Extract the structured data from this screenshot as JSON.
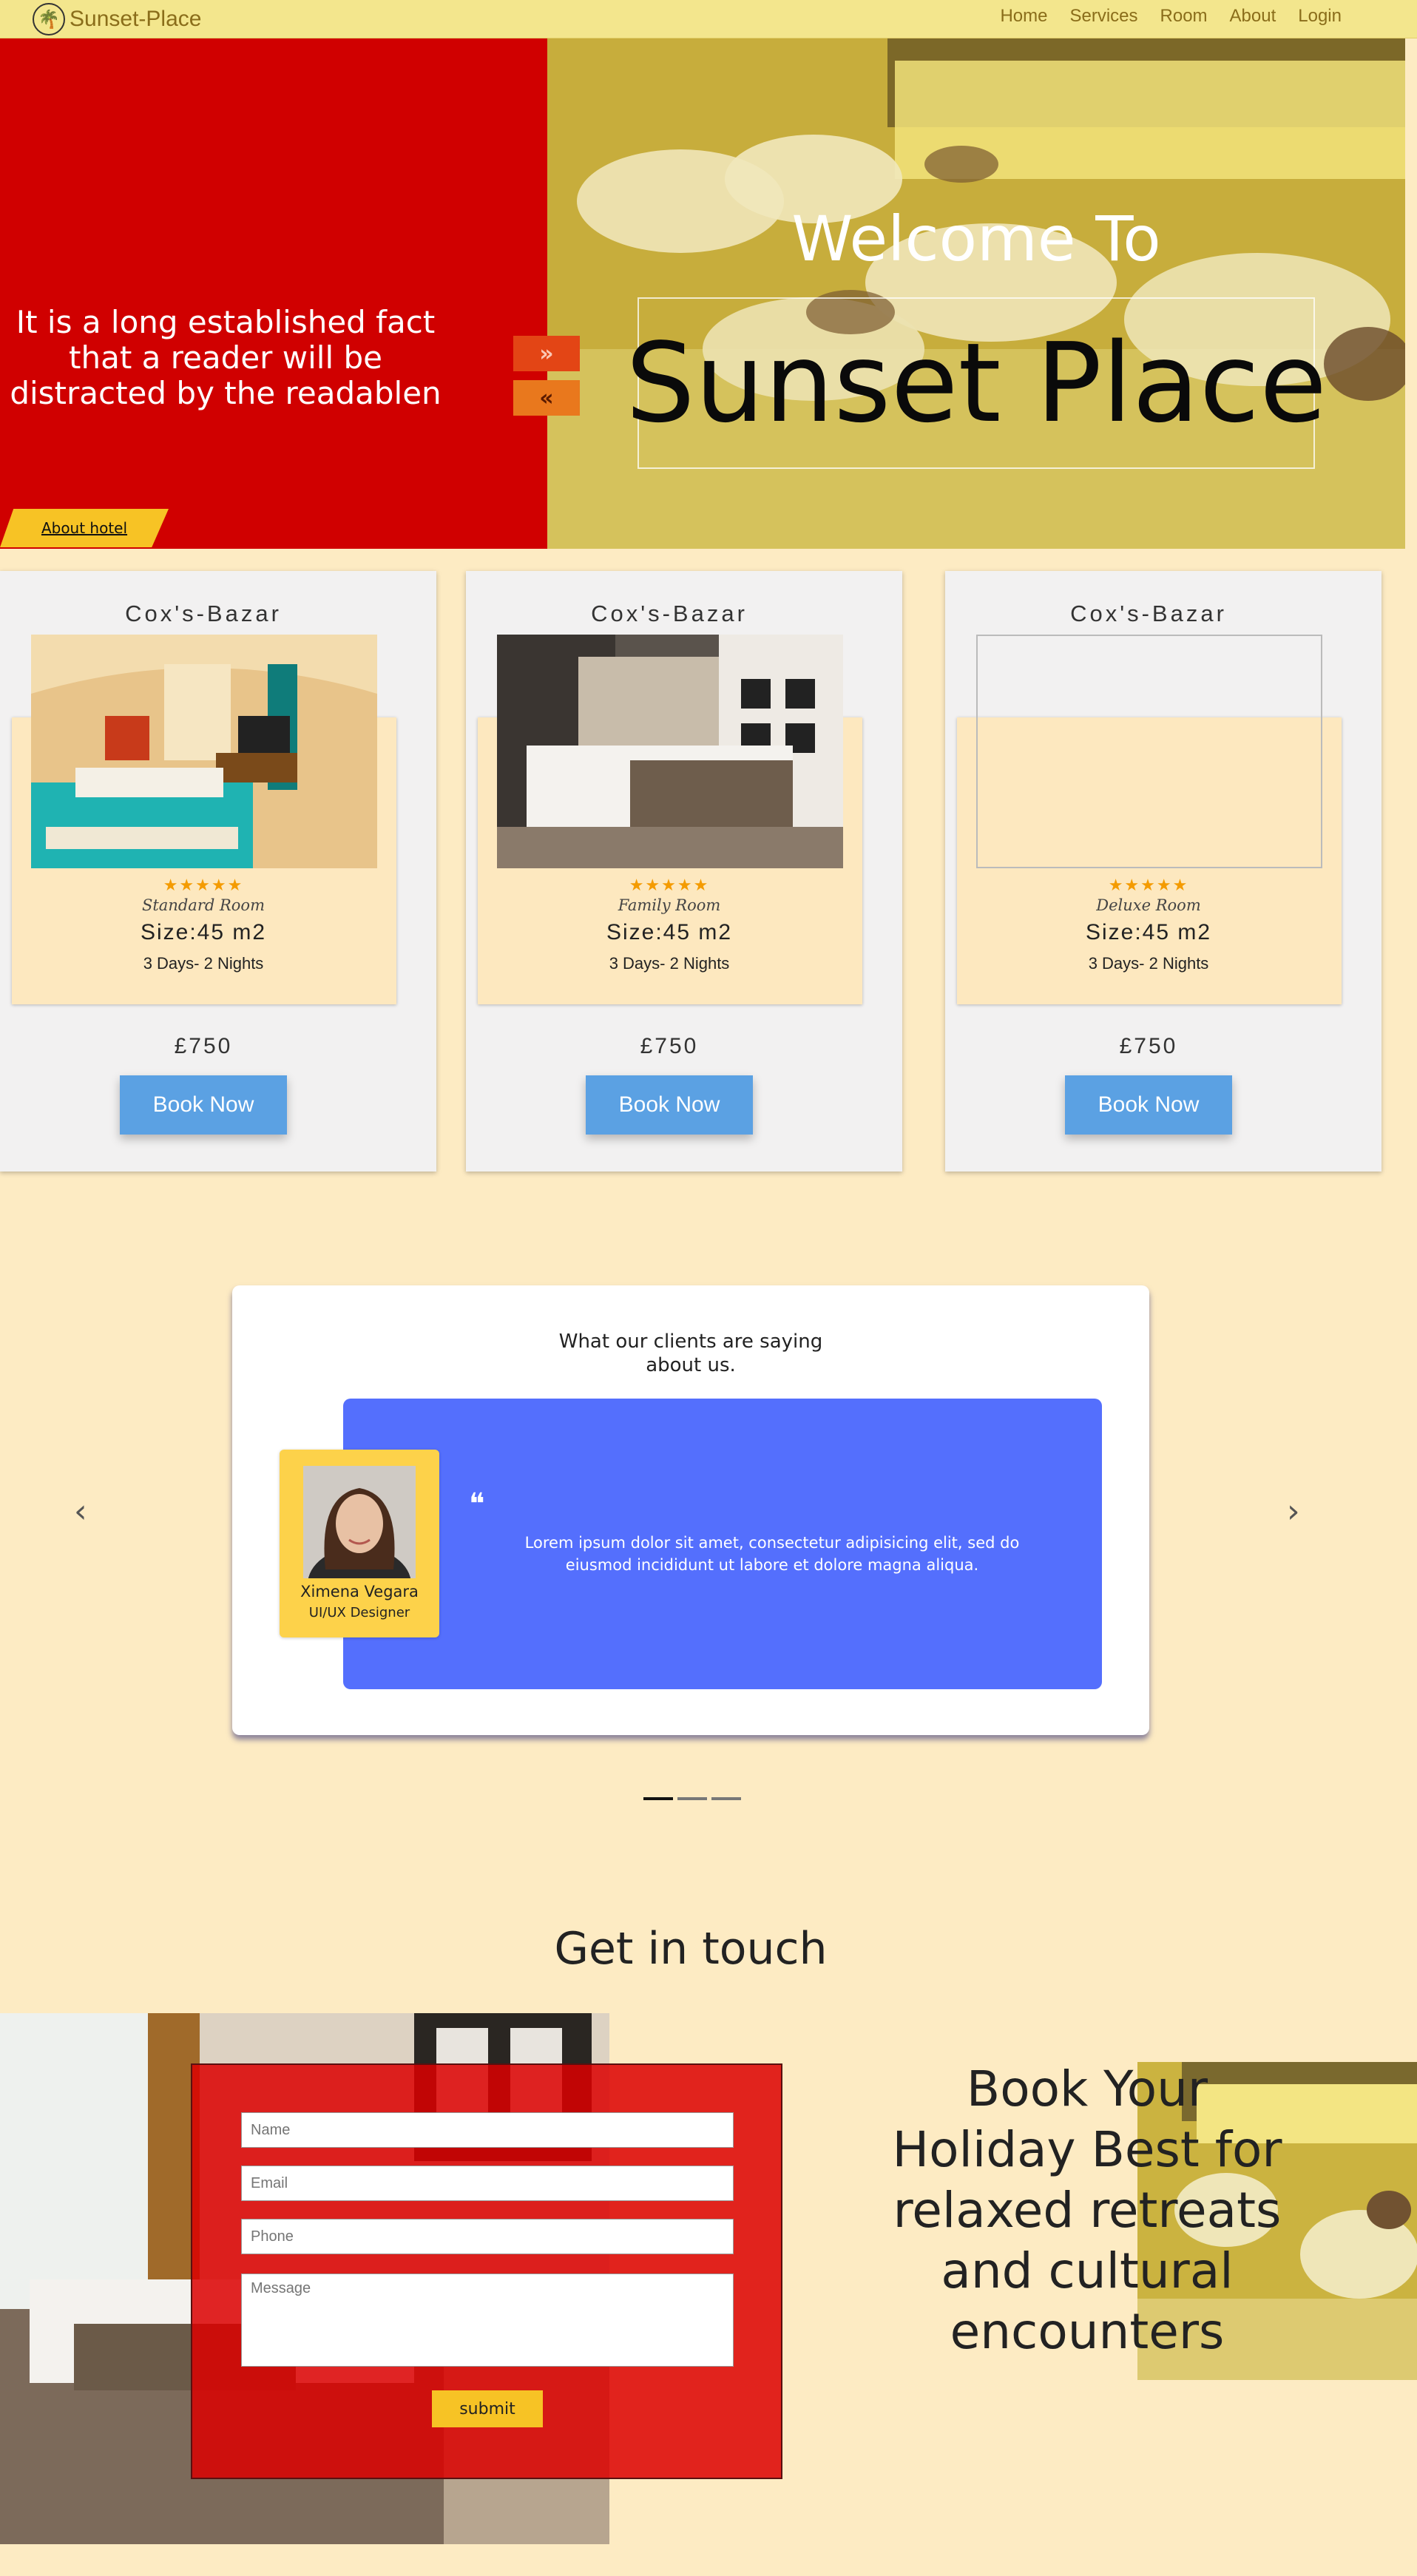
{
  "nav": {
    "brand": "Sunset-Place",
    "items": [
      "Home",
      "Services",
      "Room",
      "About",
      "Login"
    ]
  },
  "hero": {
    "tagline": "It is a long established fact that a reader will be distracted by the readablen",
    "about_button": "About hotel",
    "welcome": "Welcome To",
    "title": "Sunset Place",
    "next_arrow": "»",
    "prev_arrow": "«"
  },
  "rooms": [
    {
      "city": "Cox's-Bazar",
      "stars": "★★★★★",
      "type": "Standard Room",
      "size": "Size:45 m2",
      "nights": "3 Days- 2 Nights",
      "price": "£750",
      "button": "Book Now"
    },
    {
      "city": "Cox's-Bazar",
      "stars": "★★★★★",
      "type": "Family Room",
      "size": "Size:45 m2",
      "nights": "3 Days- 2 Nights",
      "price": "£750",
      "button": "Book Now"
    },
    {
      "city": "Cox's-Bazar",
      "stars": "★★★★★",
      "type": "Deluxe Room",
      "size": "Size:45 m2",
      "nights": "3 Days- 2 Nights",
      "price": "£750",
      "button": "Book Now"
    }
  ],
  "testimonial": {
    "heading": "What our clients are saying about us.",
    "quote_mark": "❝",
    "quote": "Lorem ipsum dolor sit amet, consectetur adipisicing elit, sed do eiusmod incididunt ut labore et dolore magna aliqua.",
    "name": "Ximena Vegara",
    "role": "UI/UX Designer",
    "prev_icon": "‹",
    "next_icon": "›"
  },
  "contact": {
    "heading": "Get in touch",
    "name_placeholder": "Name",
    "email_placeholder": "Email",
    "phone_placeholder": "Phone",
    "message_placeholder": "Message",
    "submit": "submit",
    "book_holiday": "Book Your Holiday Best for relaxed retreats and cultural encounters"
  },
  "colors": {
    "page_bg": "#fdebc3",
    "nav_bg": "#f3e68d",
    "hero_red": "#d00000",
    "accent_yellow": "#f7c325",
    "book_blue": "#5ba1e3",
    "testimonial_blue": "#546ffd"
  }
}
